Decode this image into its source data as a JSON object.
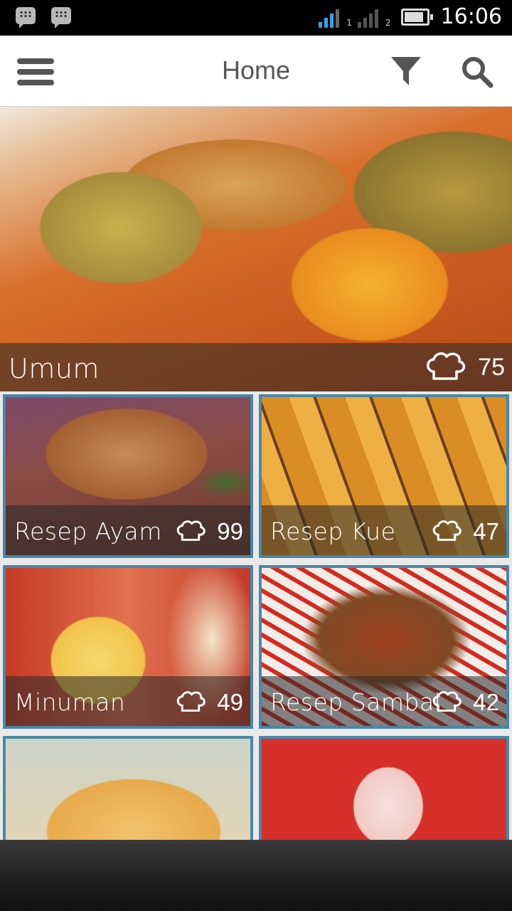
{
  "status_bar": {
    "time": "16:06",
    "sim1": "1",
    "sim2": "2"
  },
  "action_bar": {
    "title": "Home",
    "icons": [
      "menu-icon",
      "filter-icon",
      "search-icon"
    ]
  },
  "categories": [
    {
      "name": "Umum",
      "count": "75",
      "icon": "chef-hat-icon"
    },
    {
      "name": "Resep Ayam",
      "count": "99",
      "icon": "chef-hat-icon"
    },
    {
      "name": "Resep Kue",
      "count": "47",
      "icon": "chef-hat-icon"
    },
    {
      "name": "Minuman",
      "count": "49",
      "icon": "chef-hat-icon"
    },
    {
      "name": "Resep Sambal",
      "count": "42",
      "icon": "chef-hat-icon"
    }
  ],
  "colors": {
    "tile_border": "#4b87a6",
    "signal_active": "#33a3e6"
  }
}
